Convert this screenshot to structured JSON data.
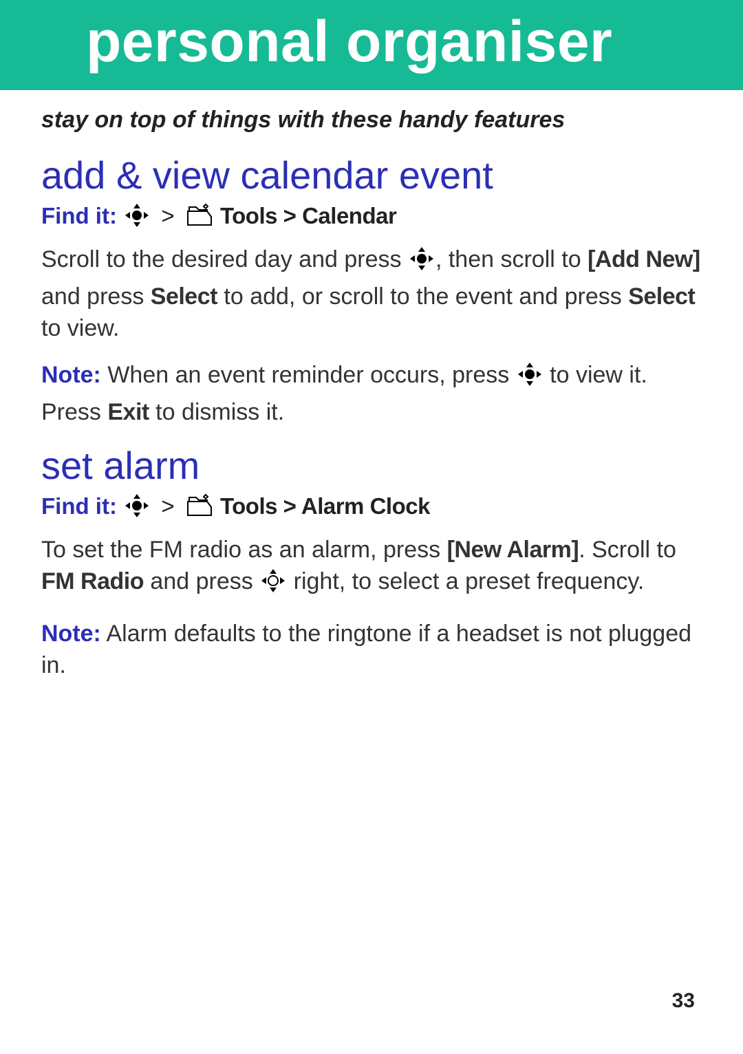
{
  "banner": {
    "title": "personal organiser"
  },
  "tagline": "stay on top of things with these handy features",
  "sections": {
    "calendar": {
      "heading": "add & view calendar event",
      "find_label": "Find it:",
      "nav_path": " Tools > Calendar",
      "body": {
        "pre": "Scroll to the desired day and press ",
        "mid1": ", then scroll to ",
        "b1": "[Add New]",
        "mid2": " and press ",
        "b2": "Select",
        "mid3": " to add, or scroll to the event and press ",
        "b3": "Select",
        "tail": " to view."
      },
      "note": {
        "label": "Note:",
        "pre": " When an event reminder occurs, press ",
        "mid": " to view it. Press ",
        "b": "Exit",
        "tail": " to dismiss it."
      }
    },
    "alarm": {
      "heading": "set alarm",
      "find_label": "Find it:",
      "nav_path": " Tools > Alarm Clock",
      "body": {
        "pre": "To set the FM radio as an alarm, press ",
        "b1": "[New Alarm]",
        "mid1": ". Scroll to ",
        "b2": "FM Radio",
        "mid2": " and press ",
        "tail": " right, to select a preset frequency."
      },
      "note": {
        "label": "Note:",
        "text": " Alarm defaults to the ringtone if a headset is not plugged in."
      }
    }
  },
  "page_number": "33"
}
